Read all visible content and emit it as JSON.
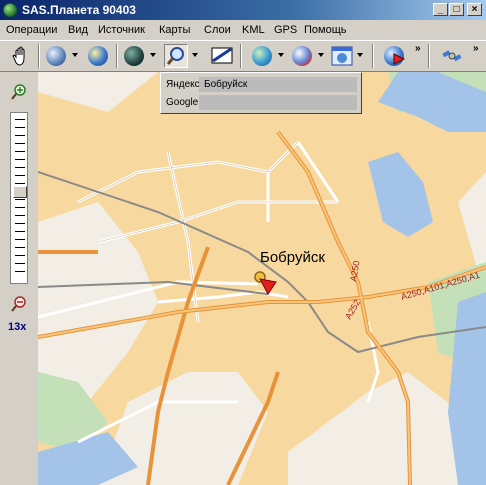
{
  "window": {
    "title": "SAS.Планета 90403"
  },
  "menu": {
    "items": [
      "Операции",
      "Вид",
      "Источник",
      "Карты",
      "Слои",
      "KML",
      "GPS",
      "Помощь"
    ]
  },
  "toolbar": {
    "buttons": [
      "hand-tool",
      "source-selector",
      "map-layer",
      "satellite-globe",
      "search",
      "screen-selection",
      "internet-globe",
      "layers-globe",
      "gps-panel",
      "marker-globe",
      "satellite"
    ]
  },
  "zoom": {
    "level": "13x"
  },
  "search_popup": {
    "yandex_label": "Яндекс",
    "yandex_value": "Бобруйск",
    "google_label": "Google!",
    "google_value": ""
  },
  "map": {
    "city_label": "Бобруйск",
    "road_labels": [
      "A250",
      "A252",
      "A250,A101,A250,A1"
    ]
  },
  "colors": {
    "title_start": "#0a246a",
    "title_end": "#a6caf0",
    "urban": "#f7d9a0",
    "water": "#a3c3e8",
    "forest": "#c4e0b8",
    "road_major": "#e8933a"
  }
}
